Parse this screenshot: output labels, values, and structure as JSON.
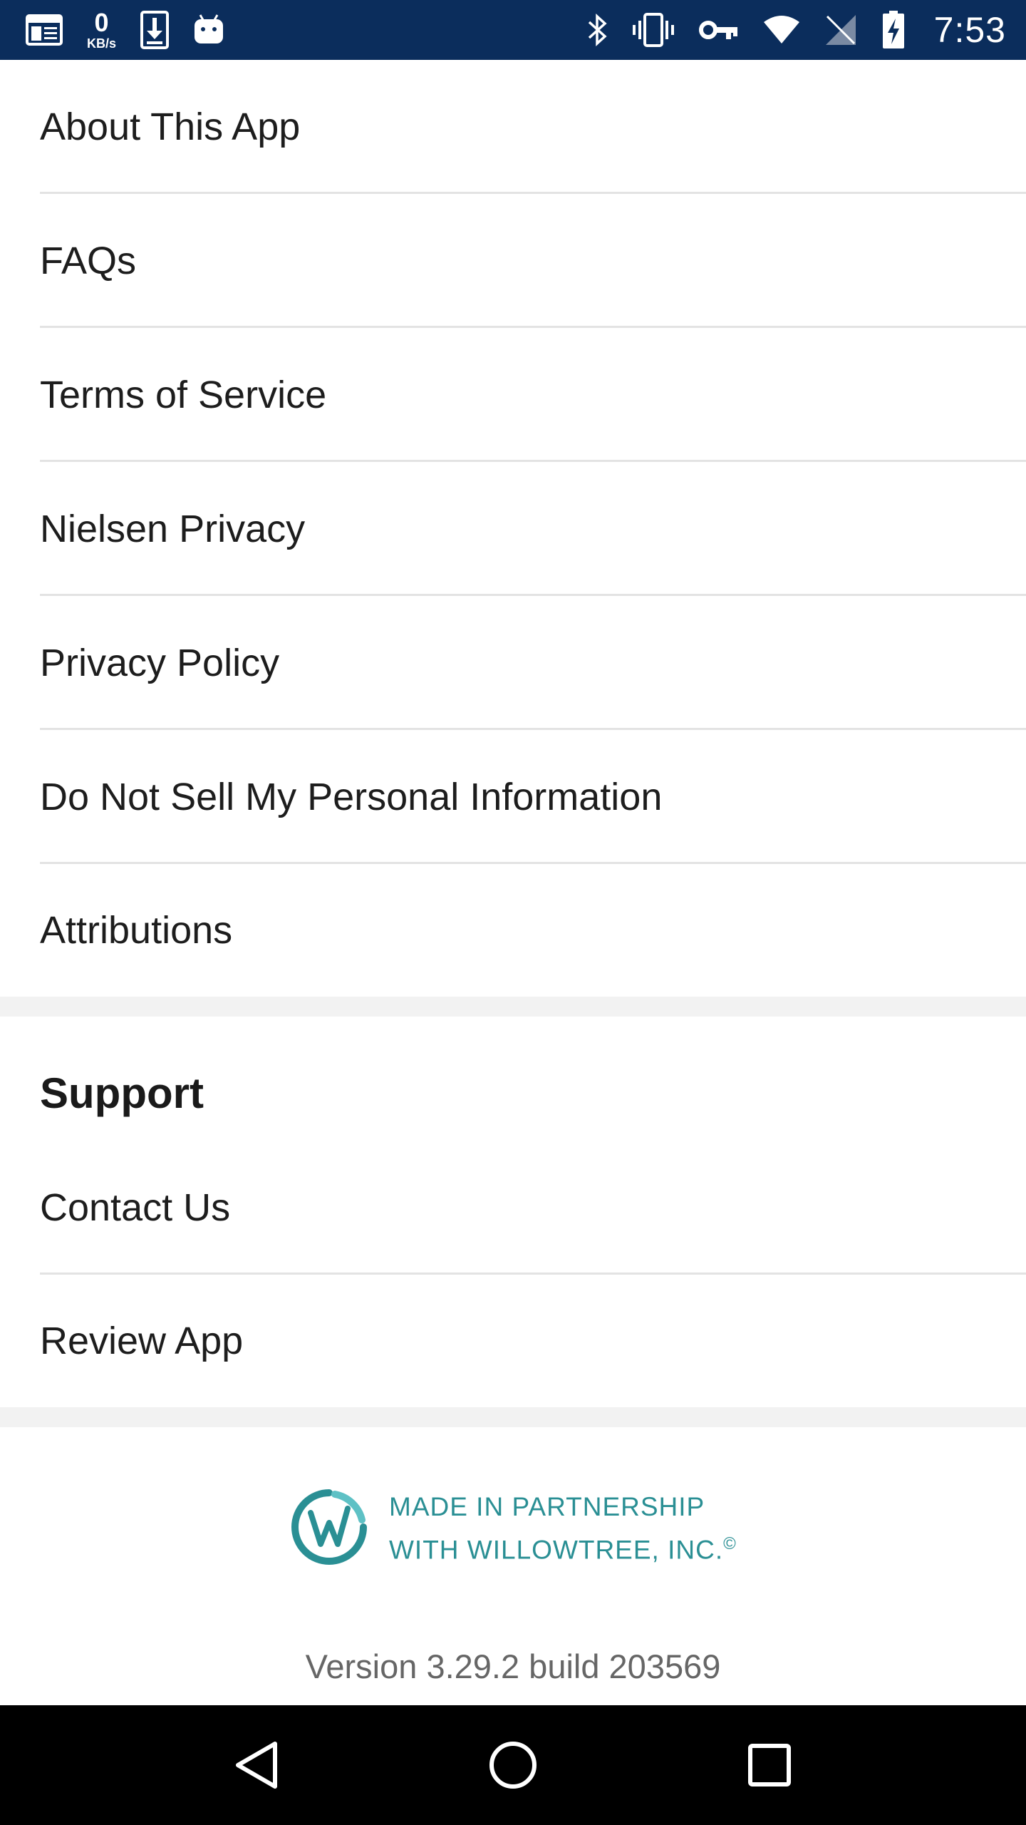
{
  "status_bar": {
    "network_speed_value": "0",
    "network_speed_unit": "KB/s",
    "time": "7:53",
    "left_icons": [
      "news-icon",
      "network-speed-icon",
      "download-icon",
      "android-icon"
    ],
    "right_icons": [
      "bluetooth-icon",
      "vibrate-icon",
      "vpn-key-icon",
      "wifi-icon",
      "signal-icon",
      "battery-charging-icon"
    ]
  },
  "menu": {
    "items": [
      {
        "label": "About This App"
      },
      {
        "label": "FAQs"
      },
      {
        "label": "Terms of Service"
      },
      {
        "label": "Nielsen Privacy"
      },
      {
        "label": "Privacy Policy"
      },
      {
        "label": "Do Not Sell My Personal Information"
      },
      {
        "label": "Attributions"
      }
    ]
  },
  "support": {
    "title": "Support",
    "items": [
      {
        "label": "Contact Us"
      },
      {
        "label": "Review App"
      }
    ]
  },
  "footer": {
    "partner_line1": "MADE IN PARTNERSHIP",
    "partner_line2": "WITH WILLOWTREE, INC.",
    "partner_mark": "©",
    "version": "Version 3.29.2 build 203569"
  },
  "colors": {
    "status_bar": "#0b2d5c",
    "partner_teal": "#2a8f94",
    "divider": "#e3e3e3",
    "section_gap": "#f2f2f2"
  }
}
